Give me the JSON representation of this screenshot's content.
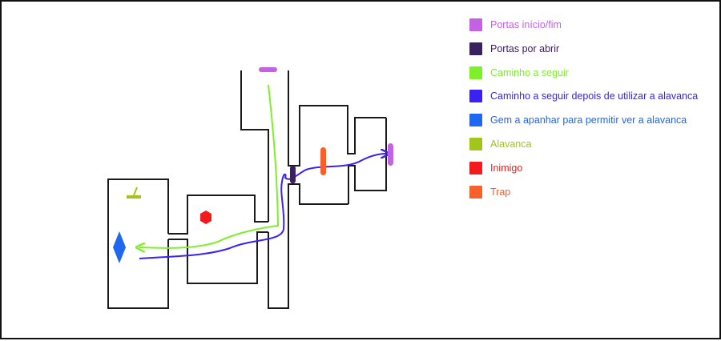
{
  "legend": {
    "items": [
      {
        "label": "Portas início/fim",
        "color": "#c462e6"
      },
      {
        "label": "Portas por abrir",
        "color": "#3b2060"
      },
      {
        "label": "Caminho a seguir",
        "color": "#7ef02a"
      },
      {
        "label": "Caminho a seguir depois de utilizar a alavanca",
        "color": "#3b21f2"
      },
      {
        "label": "Gem a apanhar para permitir ver a alavanca",
        "color": "#1f67f0"
      },
      {
        "label": "Alavanca",
        "color": "#a3c41a"
      },
      {
        "label": "Inimigo",
        "color": "#f21a1a"
      },
      {
        "label": "Trap",
        "color": "#f7602a"
      }
    ]
  },
  "map": {
    "wall_color": "#1a1a1a",
    "icons": [
      "door-start-icon",
      "door-end-icon",
      "locked-door-icon",
      "trap-icon",
      "enemy-icon",
      "lever-icon",
      "gem-icon"
    ]
  }
}
